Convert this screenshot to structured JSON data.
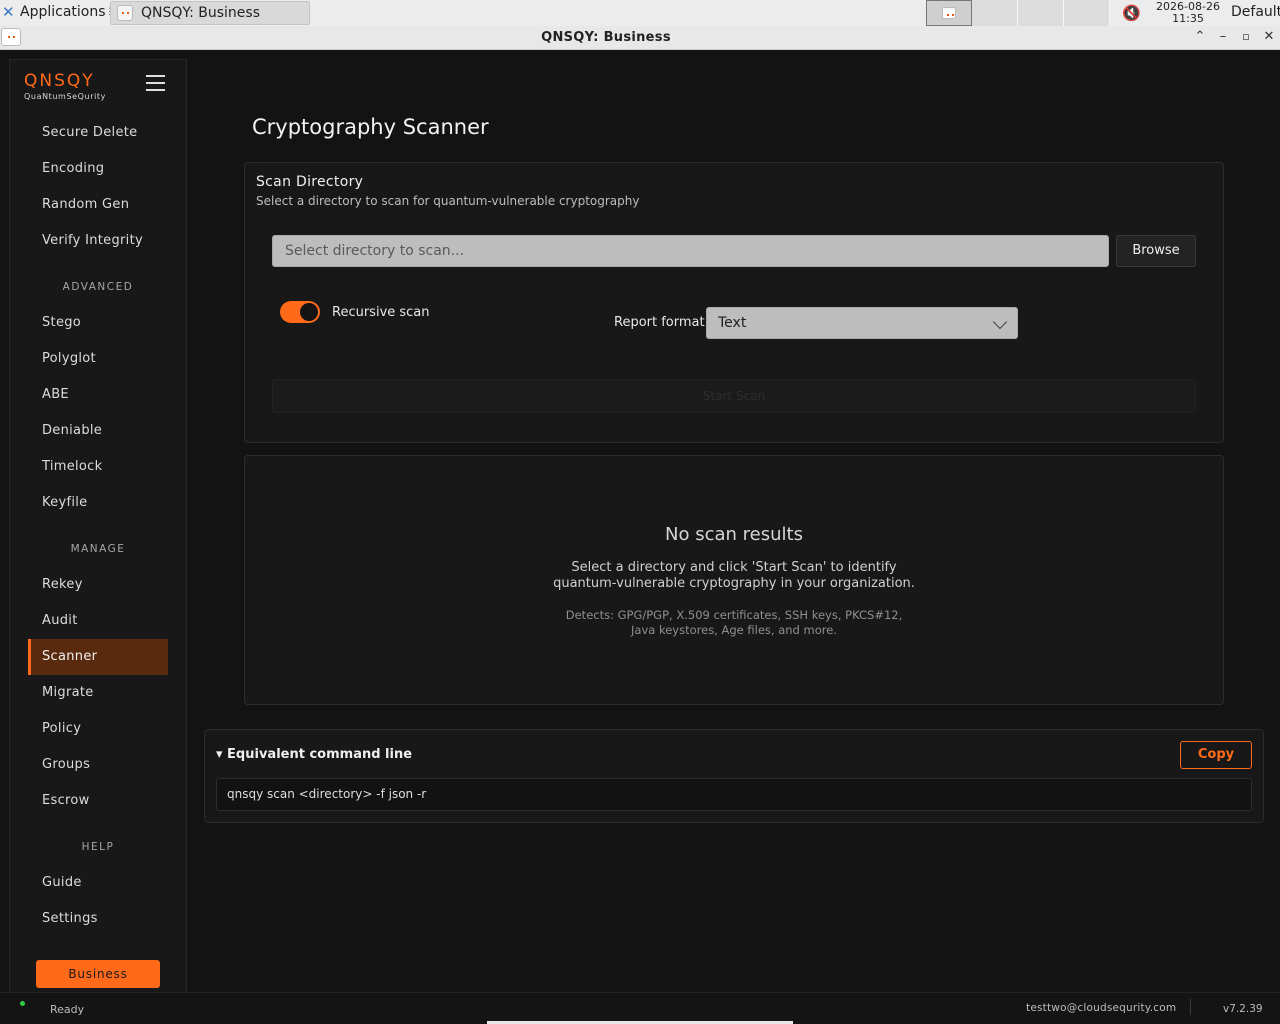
{
  "top_panel": {
    "applications_label": "Applications",
    "taskbar_title": "QNSQY: Business",
    "clock_date": "2026-08-26",
    "clock_time": "11:35",
    "default_label": "Default"
  },
  "window": {
    "title": "QNSQY: Business"
  },
  "sidebar": {
    "logo_main": "QNSQY",
    "logo_sub": "QuaNtumSeQurity",
    "groups": [
      {
        "section": "",
        "items": [
          "Secure Delete",
          "Encoding",
          "Random Gen",
          "Verify Integrity"
        ]
      },
      {
        "section": "ADVANCED",
        "items": [
          "Stego",
          "Polyglot",
          "ABE",
          "Deniable",
          "Timelock",
          "Keyfile"
        ]
      },
      {
        "section": "MANAGE",
        "items": [
          "Rekey",
          "Audit",
          "Scanner",
          "Migrate",
          "Policy",
          "Groups",
          "Escrow"
        ]
      },
      {
        "section": "HELP",
        "items": [
          "Guide",
          "Settings"
        ]
      }
    ],
    "active_item": "Scanner",
    "business_label": "Business"
  },
  "main": {
    "page_title": "Cryptography Scanner",
    "scan_card": {
      "title": "Scan Directory",
      "subtitle": "Select a directory to scan for quantum-vulnerable cryptography",
      "directory_placeholder": "Select directory to scan...",
      "browse_label": "Browse",
      "recursive_label": "Recursive scan",
      "recursive_on": true,
      "report_format_label": "Report format",
      "report_format_value": "Text",
      "start_label": "Start Scan"
    },
    "results": {
      "title": "No scan results",
      "desc_line1": "Select a directory and click 'Start Scan' to identify",
      "desc_line2": "quantum-vulnerable cryptography in your organization.",
      "detects_line1": "Detects: GPG/PGP, X.509 certificates, SSH keys, PKCS#12,",
      "detects_line2": "Java keystores, Age files, and more."
    },
    "command": {
      "toggle_label": "▾ Equivalent command line",
      "copy_label": "Copy",
      "command_text": "qnsqy scan <directory> -f json -r"
    }
  },
  "status": {
    "text": "Ready",
    "user": "testtwo@cloudsequrity.com",
    "version": "v7.2.39"
  },
  "colors": {
    "accent": "#ff6a1a",
    "active_bg": "#5a2a0e",
    "status_ok": "#2ecc40"
  }
}
